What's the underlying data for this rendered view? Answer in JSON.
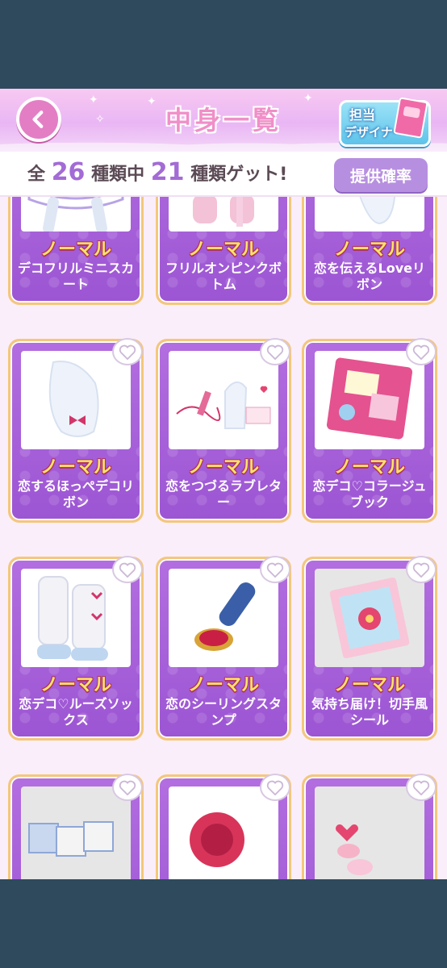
{
  "header": {
    "title": "中身一覧",
    "designer_line1": "担当",
    "designer_line2": "デザイナー"
  },
  "summary": {
    "prefix": "全",
    "total": "26",
    "middle": "種類中",
    "got": "21",
    "suffix": "種類ゲット!",
    "rate_button": "提供確率"
  },
  "items": [
    {
      "rarity": "ノーマル",
      "name": "デコフリルミニスカート",
      "art": "skirt"
    },
    {
      "rarity": "ノーマル",
      "name": "フリルオンピンクボトム",
      "art": "bottom"
    },
    {
      "rarity": "ノーマル",
      "name": "恋を伝えるLoveリボン",
      "art": "ribbon"
    },
    {
      "rarity": "ノーマル",
      "name": "恋するほっぺデコリボン",
      "art": "cheek"
    },
    {
      "rarity": "ノーマル",
      "name": "恋をつづるラブレター",
      "art": "letter"
    },
    {
      "rarity": "ノーマル",
      "name": "恋デコ♡コラージュブック",
      "art": "book"
    },
    {
      "rarity": "ノーマル",
      "name": "恋デコ♡ルーズソックス",
      "art": "socks"
    },
    {
      "rarity": "ノーマル",
      "name": "恋のシーリングスタンプ",
      "art": "stamp"
    },
    {
      "rarity": "ノーマル",
      "name": "気持ち届け！切手風シール",
      "art": "sticker"
    },
    {
      "rarity": "",
      "name": "",
      "art": "love"
    },
    {
      "rarity": "",
      "name": "",
      "art": "rose"
    },
    {
      "rarity": "",
      "name": "",
      "art": "hearts"
    }
  ],
  "colors": {
    "accent": "#a36bd6",
    "card": "#b36ee0",
    "rarity": "#ffe46a"
  }
}
